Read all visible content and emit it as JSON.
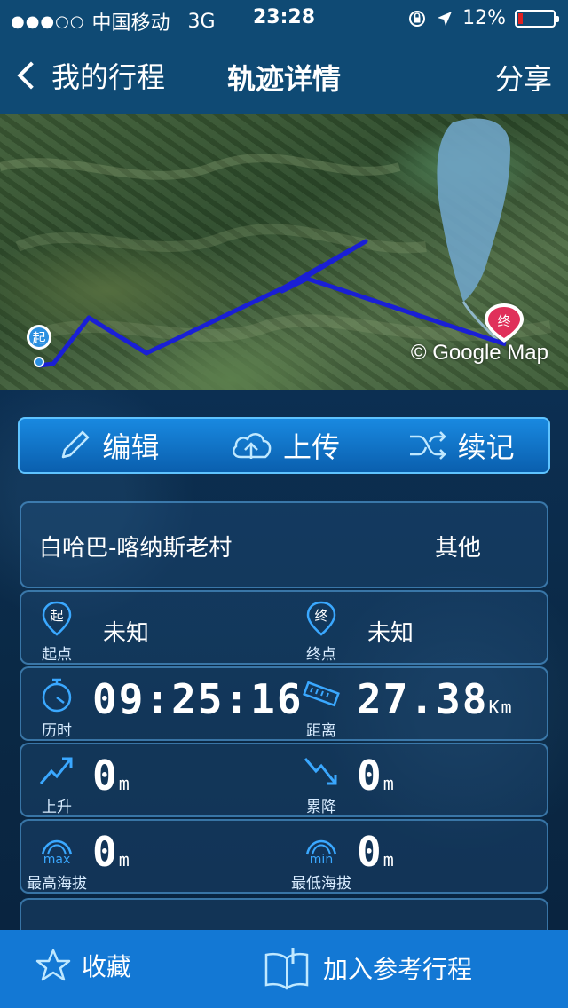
{
  "status_bar": {
    "signal": "●●●○○",
    "carrier": "中国移动",
    "network": "3G",
    "time": "23:28",
    "battery": "12%",
    "battery_level": 0.12
  },
  "nav": {
    "back_label": "我的行程",
    "title": "轨迹详情",
    "share_label": "分享"
  },
  "map": {
    "start_marker": "起",
    "end_marker": "终",
    "attribution": "© Google Map"
  },
  "actions": {
    "edit": "编辑",
    "upload": "上传",
    "continue": "续记"
  },
  "trip": {
    "route": "白哈巴-喀纳斯老村",
    "type": "其他"
  },
  "stats": {
    "start": {
      "icon_text": "起",
      "label": "起点",
      "value": "未知"
    },
    "end": {
      "icon_text": "终",
      "label": "终点",
      "value": "未知"
    },
    "duration": {
      "label": "历时",
      "value": "09:25:16"
    },
    "distance": {
      "label": "距离",
      "value": "27.38",
      "unit": "Km"
    },
    "ascent": {
      "label": "上升",
      "value": "0",
      "unit": "m"
    },
    "descent": {
      "label": "累降",
      "value": "0",
      "unit": "m"
    },
    "max_alt": {
      "icon_text": "max",
      "label": "最高海拔",
      "value": "0",
      "unit": "m"
    },
    "min_alt": {
      "icon_text": "min",
      "label": "最低海拔",
      "value": "0",
      "unit": "m"
    }
  },
  "bottom": {
    "favorite": "收藏",
    "add_reference": "加入参考行程"
  },
  "colors": {
    "nav_bg": "#0f4a74",
    "action_blue": "#1989e0",
    "bottom_bar": "#1378d4",
    "track": "#1a1fd6",
    "end_pin": "#e0305a",
    "start_pin": "#2b8fe0"
  }
}
